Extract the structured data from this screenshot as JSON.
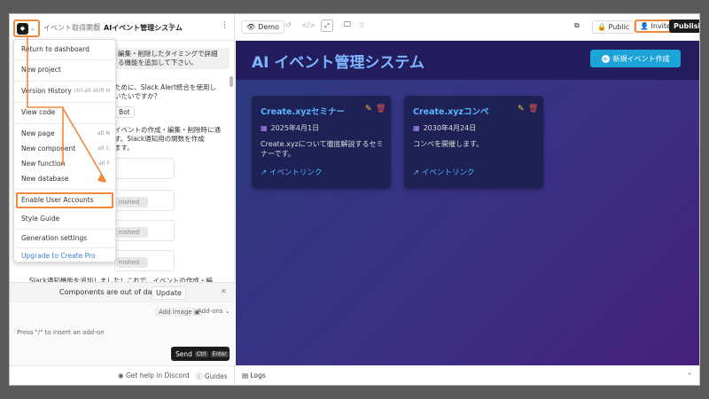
{
  "breadcrumb": {
    "parent": "イベント取得関数",
    "separator": "/",
    "current": "AIイベント管理システム"
  },
  "logo_glyph": "◆",
  "menu": {
    "items": [
      {
        "label": "Return to dashboard",
        "shortcut": ""
      },
      {
        "label": "New project",
        "shortcut": ""
      },
      {
        "label": "Version History",
        "shortcut": "ctrl alt shift H"
      },
      {
        "label": "View code",
        "shortcut": ""
      },
      {
        "label": "New page",
        "shortcut": "alt N"
      },
      {
        "label": "New component",
        "shortcut": "alt C"
      },
      {
        "label": "New function",
        "shortcut": "alt F"
      },
      {
        "label": "New database",
        "shortcut": ""
      },
      {
        "label": "Enable User Accounts",
        "shortcut": ""
      },
      {
        "label": "Style Guide",
        "shortcut": ""
      },
      {
        "label": "Generation settings",
        "shortcut": ""
      },
      {
        "label": "Upgrade to Create Pro",
        "shortcut": ""
      }
    ]
  },
  "chat": {
    "msg1": "編集・削除したタイミングで詳細\nる機能を追加して下さい。",
    "msg2": "ために、Slack Alert統合を使用し\nいたいですか？",
    "msg2_btn": "Bot",
    "msg3": "イベントの作成・編集・削除時に通\nす。Slack通知用の関数を作成\nます。",
    "badge": "nished",
    "msg4": "Slack通知機能を追加しました！これで、イベントの作成・編\n集・削除を行うたびに、その詳細情報がSlackに通知されます。"
  },
  "out_of_date": {
    "text": "Components are out of date",
    "update": "Update",
    "close": "✕"
  },
  "composer": {
    "add_image": "Add image",
    "addons": "Add-ons",
    "placeholder": "Press \"/\" to insert an add-on",
    "send": "Send",
    "k1": "Ctrl",
    "k2": "Enter"
  },
  "footer": {
    "discord": "Get help in Discord",
    "guides": "Guides",
    "logs": "Logs"
  },
  "toolbar": {
    "demo": "Demo",
    "public": "Public",
    "invite": "Invite",
    "publish": "Publish"
  },
  "app": {
    "title": "AI イベント管理システム",
    "new_button": "新規イベント作成",
    "events": [
      {
        "title": "Create.xyzセミナー",
        "date": "2025年4月1日",
        "description": "Create.xyzについて徹底解説するセミナーです。",
        "link": "イベントリンク"
      },
      {
        "title": "Create.xyzコンペ",
        "date": "2030年4月24日",
        "description": "コンペを開催します。",
        "link": "イベントリンク"
      }
    ]
  },
  "colors": {
    "highlight": "#f0883e",
    "accent": "#1ca4d8",
    "link": "#52b0ff"
  }
}
